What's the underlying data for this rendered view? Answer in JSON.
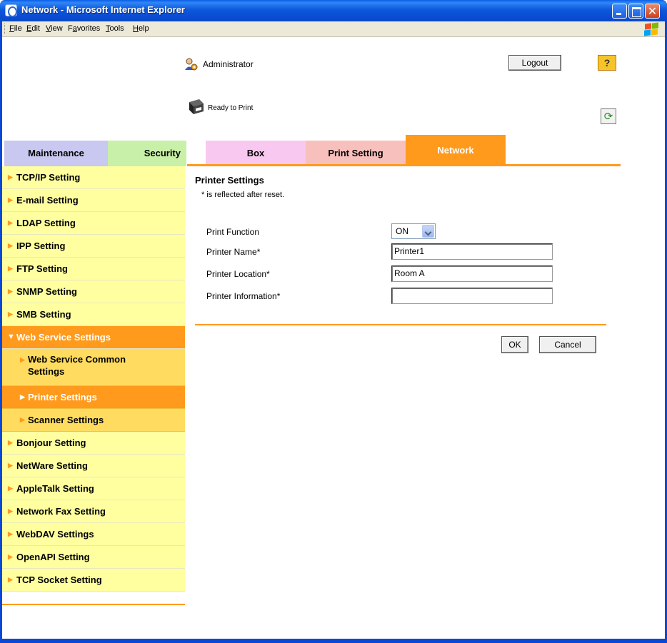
{
  "window": {
    "title": "Network - Microsoft Internet Explorer",
    "close_glyph": "✕"
  },
  "menu": {
    "items": [
      {
        "mnemonic": "F",
        "rest": "ile"
      },
      {
        "mnemonic": "E",
        "rest": "dit"
      },
      {
        "mnemonic": "V",
        "rest": "iew"
      },
      {
        "pre": "F",
        "mnemonic": "a",
        "rest": "vorites"
      },
      {
        "mnemonic": "T",
        "rest": "ools"
      },
      {
        "mnemonic": "H",
        "rest": "elp"
      }
    ]
  },
  "header": {
    "user": "Administrator",
    "logout": "Logout",
    "help": "?",
    "status": "Ready to Print",
    "refresh_glyph": "⟳"
  },
  "tabs": [
    "Maintenance",
    "Security",
    "Box",
    "Print Setting",
    "Network"
  ],
  "colors": {
    "accent": "#ff9a1c",
    "sidebar_bg": "#ffffa0",
    "submenu_bg": "#ffdc60"
  },
  "sidebar": {
    "arrow": "▶",
    "open_arrow": "▼",
    "items_before": [
      "TCP/IP Setting",
      "E-mail Setting",
      "LDAP Setting",
      "IPP Setting",
      "FTP Setting",
      "SNMP Setting",
      "SMB Setting"
    ],
    "open_item": "Web Service Settings",
    "sub_items": [
      {
        "line1": "Web Service Common",
        "line2": "Settings"
      },
      {
        "line1": "Printer Settings"
      },
      {
        "line1": "Scanner Settings"
      }
    ],
    "items_after": [
      "Bonjour Setting",
      "NetWare Setting",
      "AppleTalk Setting",
      "Network Fax Setting",
      "WebDAV Settings",
      "OpenAPI Setting",
      "TCP Socket Setting"
    ]
  },
  "panel": {
    "title": "Printer Settings",
    "note": "* is reflected after reset.",
    "fields": {
      "print_function": {
        "label": "Print Function",
        "value": "ON"
      },
      "printer_name": {
        "label": "Printer Name*",
        "value": "Printer1"
      },
      "printer_location": {
        "label": "Printer Location*",
        "value": "Room A"
      },
      "printer_information": {
        "label": "Printer Information*",
        "value": ""
      }
    },
    "ok": "OK",
    "cancel": "Cancel"
  }
}
